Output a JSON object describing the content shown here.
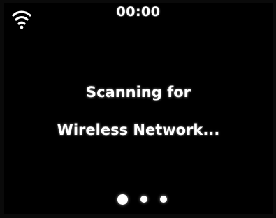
{
  "status_bar": {
    "time": "00:00",
    "wifi_icon": "wifi-icon"
  },
  "main": {
    "message_line1": "Scanning for",
    "message_line2": "Wireless Network..."
  },
  "progress": {
    "total_steps": 3,
    "active_step": 1
  },
  "colors": {
    "background": "#000000",
    "text": "#ffffff"
  }
}
